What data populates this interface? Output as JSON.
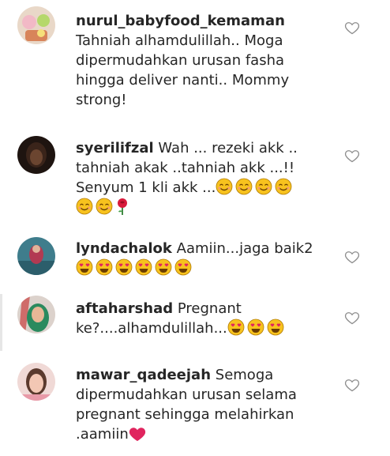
{
  "comments": [
    {
      "username": "nurul_babyfood_kemaman",
      "text": "Tahniah alhamdulillah.. Moga dipermudahkan urusan fasha hingga deliver nanti.. Mommy strong!",
      "emojis": []
    },
    {
      "username": "syerilifzal",
      "text": "Wah ... rezeki akk .. tahniah akak ..tahniah akk ...!! Senyum 1 kli akk ...",
      "emojis": [
        "smiling-face-icon",
        "smiling-face-icon",
        "smiling-face-icon",
        "smiling-face-icon",
        "smiling-face-icon",
        "smiling-face-icon",
        "rose-icon"
      ]
    },
    {
      "username": "lyndachalok",
      "text": "Aamiin...jaga baik2",
      "emojis": [
        "heart-eyes-icon",
        "heart-eyes-icon",
        "heart-eyes-icon",
        "heart-eyes-icon",
        "heart-eyes-icon",
        "heart-eyes-icon"
      ]
    },
    {
      "username": "aftaharshad",
      "text": "Pregnant ke?....alhamdulillah...",
      "emojis": [
        "heart-eyes-icon",
        "heart-eyes-icon",
        "heart-eyes-icon"
      ]
    },
    {
      "username": "mawar_qadeejah",
      "text": "Semoga dipermudahkan urusan selama pregnant sehingga melahirkan .aamiin",
      "emojis": [
        "red-heart-icon"
      ]
    }
  ],
  "colors": {
    "text": "#262626",
    "heart_outline": "#8e8e8e",
    "emoji_face": "#f7c21e",
    "emoji_heart": "#e0245e"
  }
}
